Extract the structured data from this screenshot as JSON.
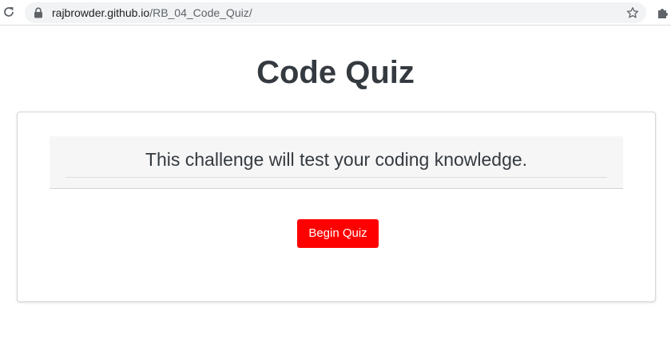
{
  "browser": {
    "url_host": "rajbrowder.github.io",
    "url_path": "/RB_04_Code_Quiz/",
    "icons": [
      "reload-icon",
      "lock-icon",
      "star-icon",
      "extensions-icon"
    ]
  },
  "page": {
    "title": "Code Quiz",
    "intro": "This challenge will test your coding knowledge.",
    "begin_button": "Begin Quiz"
  },
  "colors": {
    "title_text": "#343a40",
    "button_bg": "#ff0000",
    "button_text": "#ffffff",
    "jumbotron_bg": "#f6f6f6"
  }
}
